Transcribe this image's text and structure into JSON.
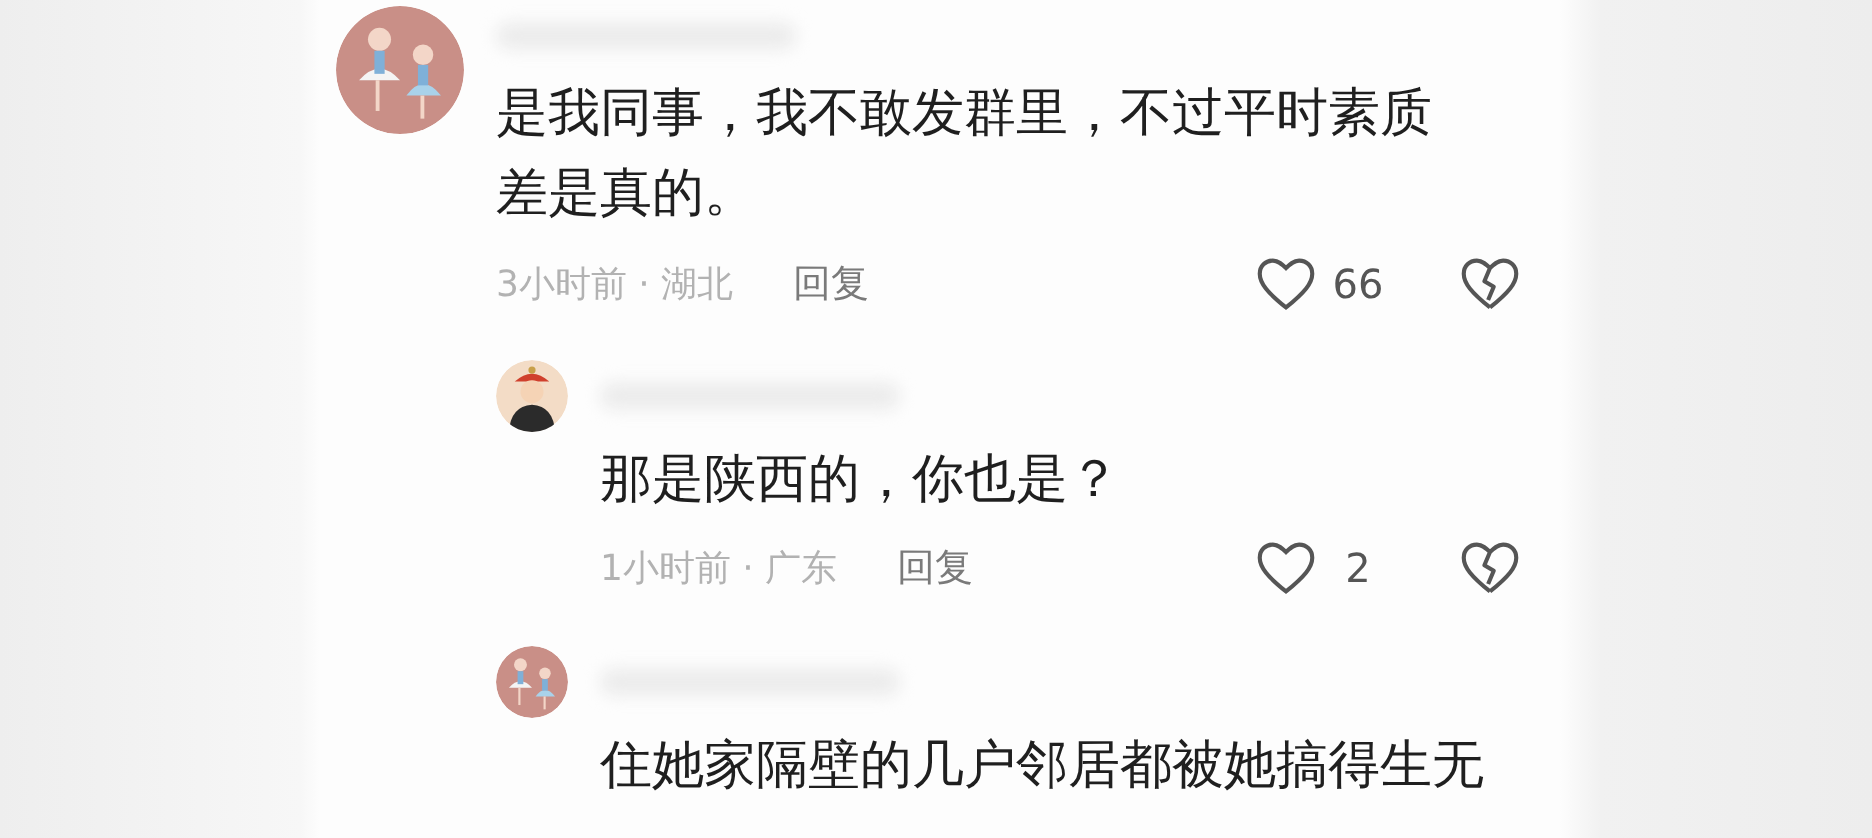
{
  "comments": [
    {
      "text": "是我同事，我不敢发群里，不过平时素质差是真的。",
      "time_region": "3小时前 · 湖北",
      "reply_label": "回复",
      "likes": "66",
      "liked": false,
      "avatar": {
        "kind": "dancers"
      },
      "children": [
        {
          "text": "那是陕西的，你也是？",
          "time_region": "1小时前 · 广东",
          "reply_label": "回复",
          "likes": "2",
          "liked": false,
          "avatar": {
            "kind": "official"
          }
        },
        {
          "text": "住她家隔壁的几户邻居都被她搞得生无",
          "avatar": {
            "kind": "dancers"
          }
        }
      ]
    }
  ]
}
